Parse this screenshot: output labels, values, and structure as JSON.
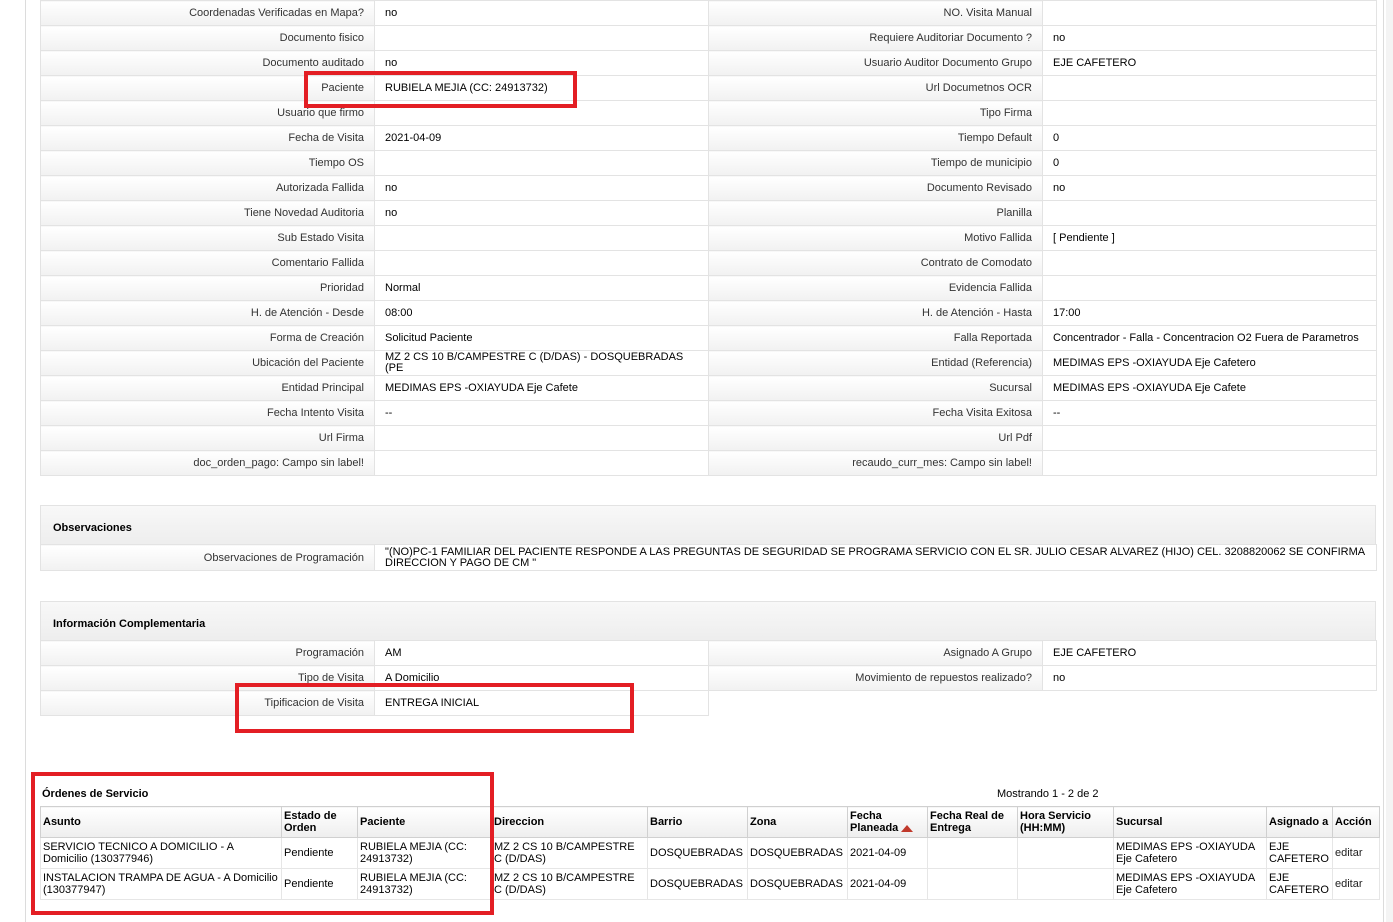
{
  "main_fields": [
    {
      "l1": "Coordenadas Verificadas en Mapa?",
      "v1": "no",
      "l2": "NO. Visita Manual",
      "v2": ""
    },
    {
      "l1": "Documento fisico",
      "v1": "",
      "l2": "Requiere Auditoriar Documento ?",
      "v2": "no"
    },
    {
      "l1": "Documento auditado",
      "v1": "no",
      "l2": "Usuario Auditor Documento Grupo",
      "v2": "EJE CAFETERO"
    },
    {
      "l1": "Paciente",
      "v1": "RUBIELA MEJIA (CC: 24913732)",
      "l2": "Url Documetnos OCR",
      "v2": ""
    },
    {
      "l1": "Usuario que firmo",
      "v1": "",
      "l2": "Tipo Firma",
      "v2": ""
    },
    {
      "l1": "Fecha de Visita",
      "v1": "2021-04-09",
      "l2": "Tiempo Default",
      "v2": "0"
    },
    {
      "l1": "Tiempo OS",
      "v1": "",
      "l2": "Tiempo de municipio",
      "v2": "0"
    },
    {
      "l1": "Autorizada Fallida",
      "v1": "no",
      "l2": "Documento Revisado",
      "v2": "no"
    },
    {
      "l1": "Tiene Novedad Auditoria",
      "v1": "no",
      "l2": "Planilla",
      "v2": ""
    },
    {
      "l1": "Sub Estado Visita",
      "v1": "",
      "l2": "Motivo Fallida",
      "v2": "[ Pendiente ]"
    },
    {
      "l1": "Comentario Fallida",
      "v1": "",
      "l2": "Contrato de Comodato",
      "v2": ""
    },
    {
      "l1": "Prioridad",
      "v1": "Normal",
      "l2": "Evidencia Fallida",
      "v2": ""
    },
    {
      "l1": "H. de Atención - Desde",
      "v1": "08:00",
      "l2": "H. de Atención - Hasta",
      "v2": "17:00"
    },
    {
      "l1": "Forma de Creación",
      "v1": "Solicitud Paciente",
      "l2": "Falla Reportada",
      "v2": "Concentrador - Falla - Concentracion O2 Fuera de Parametros"
    },
    {
      "l1": "Ubicación del Paciente",
      "v1": "MZ 2 CS 10 B/CAMPESTRE C (D/DAS) - DOSQUEBRADAS (PE",
      "l2": "Entidad (Referencia)",
      "v2": "MEDIMAS EPS -OXIAYUDA Eje Cafetero"
    },
    {
      "l1": "Entidad Principal",
      "v1": "MEDIMAS EPS -OXIAYUDA Eje Cafete",
      "l2": "Sucursal",
      "v2": "MEDIMAS EPS -OXIAYUDA Eje Cafete"
    },
    {
      "l1": "Fecha Intento Visita",
      "v1": "--",
      "l2": "Fecha Visita Exitosa",
      "v2": "--"
    },
    {
      "l1": "Url Firma",
      "v1": "",
      "l2": "Url Pdf",
      "v2": ""
    },
    {
      "l1": "doc_orden_pago: Campo sin label!",
      "v1": "",
      "l2": "recaudo_curr_mes: Campo sin label!",
      "v2": ""
    }
  ],
  "observaciones": {
    "title": "Observaciones",
    "label": "Observaciones de Programación",
    "value": "\"(NO)PC-1 FAMILIAR DEL PACIENTE RESPONDE A LAS PREGUNTAS DE SEGURIDAD SE PROGRAMA SERVICIO CON EL SR. JULIO CESAR ALVAREZ (HIJO) CEL. 3208820062 SE CONFIRMA DIRECCION Y PAGO DE CM \""
  },
  "info_complementaria": {
    "title": "Información Complementaria",
    "rows": [
      {
        "l1": "Programación",
        "v1": "AM",
        "l2": "Asignado A Grupo",
        "v2": "EJE CAFETERO"
      },
      {
        "l1": "Tipo de Visita",
        "v1": "A Domicilio",
        "l2": "Movimiento de repuestos realizado?",
        "v2": "no"
      },
      {
        "l1": "Tipificacion de Visita",
        "v1": "ENTREGA INICIAL"
      }
    ]
  },
  "ordenes": {
    "title": "Órdenes de Servicio",
    "count_text": "Mostrando 1 - 2 de 2",
    "columns": [
      "Asunto",
      "Estado de Orden",
      "Paciente",
      "Direccion",
      "Barrio",
      "Zona",
      "Fecha Planeada",
      "Fecha Real de Entrega",
      "Hora Servicio (HH:MM)",
      "Sucursal",
      "Asignado a",
      "Acción"
    ],
    "rows": [
      {
        "asunto": "SERVICIO TECNICO A DOMICILIO - A Domicilio (130377946)",
        "estado": "Pendiente",
        "paciente": "RUBIELA MEJIA (CC: 24913732)",
        "direccion": "MZ 2 CS 10 B/CAMPESTRE C (D/DAS)",
        "barrio": "DOSQUEBRADAS",
        "zona": "DOSQUEBRADAS",
        "fecha_planeada": "2021-04-09",
        "fecha_real": "",
        "hora": "",
        "sucursal": "MEDIMAS EPS -OXIAYUDA Eje Cafetero",
        "asignado": "EJE CAFETERO",
        "accion": "editar"
      },
      {
        "asunto": "INSTALACION TRAMPA DE AGUA - A Domicilio (130377947)",
        "estado": "Pendiente",
        "paciente": "RUBIELA MEJIA (CC: 24913732)",
        "direccion": "MZ 2 CS 10 B/CAMPESTRE C (D/DAS)",
        "barrio": "DOSQUEBRADAS",
        "zona": "DOSQUEBRADAS",
        "fecha_planeada": "2021-04-09",
        "fecha_real": "",
        "hora": "",
        "sucursal": "MEDIMAS EPS -OXIAYUDA Eje Cafetero",
        "asignado": "EJE CAFETERO",
        "accion": "editar"
      }
    ]
  },
  "highlight_color": "#e31e24"
}
